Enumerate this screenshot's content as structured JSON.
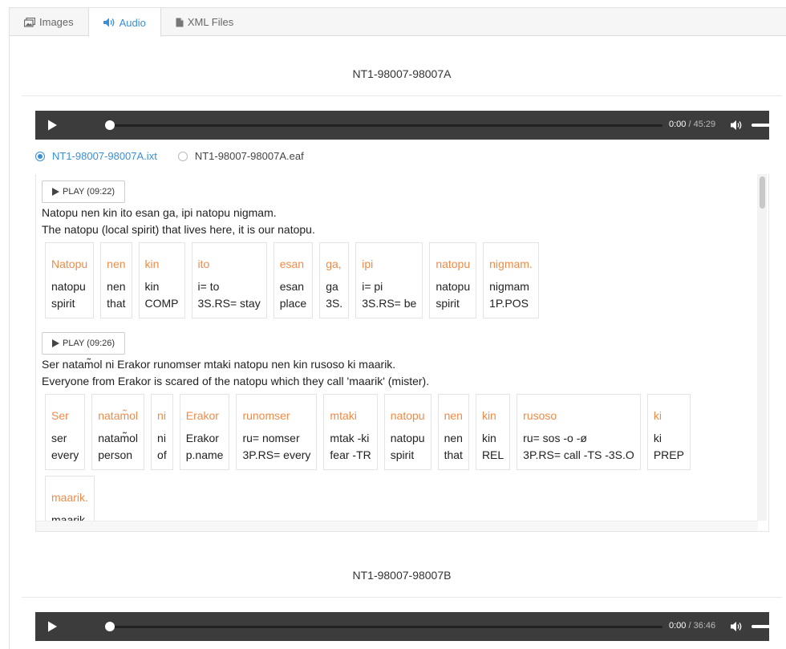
{
  "tabs": [
    {
      "label": "Images",
      "icon": "images-icon",
      "active": false
    },
    {
      "label": "Audio",
      "icon": "audio-icon",
      "active": true
    },
    {
      "label": "XML Files",
      "icon": "file-icon",
      "active": false
    }
  ],
  "records": [
    {
      "title": "NT1-98007-98007A",
      "player": {
        "current": "0:00",
        "separator": "/",
        "duration": "45:29",
        "progress": 0.0,
        "volume": 1.0
      },
      "files": [
        {
          "label": "NT1-98007-98007A.ixt",
          "checked": true
        },
        {
          "label": "NT1-98007-98007A.eaf",
          "checked": false
        }
      ],
      "segments": [
        {
          "play_label": "PLAY (09:22)",
          "original": "Natopu nen kin ito esan ga, ipi natopu nigmam.",
          "translation": "The natopu (local spirit) that lives here, it is our natopu.",
          "words": [
            {
              "word": "Natopu",
              "morph": "natopu",
              "gloss": "spirit"
            },
            {
              "word": "nen",
              "morph": "nen",
              "gloss": "that"
            },
            {
              "word": "kin",
              "morph": "kin",
              "gloss": "COMP"
            },
            {
              "word": "ito",
              "morph": "i= to",
              "gloss": "3S.RS= stay"
            },
            {
              "word": "esan",
              "morph": "esan",
              "gloss": "place"
            },
            {
              "word": "ga,",
              "morph": "ga",
              "gloss": "3S."
            },
            {
              "word": "ipi",
              "morph": "i= pi",
              "gloss": "3S.RS= be"
            },
            {
              "word": "natopu",
              "morph": "natopu",
              "gloss": "spirit"
            },
            {
              "word": "nigmam.",
              "morph": "nigmam",
              "gloss": "1P.POS"
            }
          ]
        },
        {
          "play_label": "PLAY (09:26)",
          "original": "Ser natam̃ol ni Erakor runomser mtaki natopu nen kin rusoso ki maarik.",
          "translation": "Everyone from Erakor is scared of the natopu which they call 'maarik' (mister).",
          "words": [
            {
              "word": "Ser",
              "morph": "ser",
              "gloss": "every"
            },
            {
              "word": "natam̃ol",
              "morph": "natam̃ol",
              "gloss": "person"
            },
            {
              "word": "ni",
              "morph": "ni",
              "gloss": "of"
            },
            {
              "word": "Erakor",
              "morph": "Erakor",
              "gloss": "p.name"
            },
            {
              "word": "runomser",
              "morph": "ru= nomser",
              "gloss": "3P.RS= every"
            },
            {
              "word": "mtaki",
              "morph": "mtak -ki",
              "gloss": "fear -TR"
            },
            {
              "word": "natopu",
              "morph": "natopu",
              "gloss": "spirit"
            },
            {
              "word": "nen",
              "morph": "nen",
              "gloss": "that"
            },
            {
              "word": "kin",
              "morph": "kin",
              "gloss": "REL"
            },
            {
              "word": "rusoso",
              "morph": "ru= sos -o -ø",
              "gloss": "3P.RS= call -TS -3S.O"
            },
            {
              "word": "ki",
              "morph": "ki",
              "gloss": "PREP"
            },
            {
              "word": "maarik.",
              "morph": "maarik",
              "gloss": ""
            }
          ]
        }
      ]
    },
    {
      "title": "NT1-98007-98007B",
      "player": {
        "current": "0:00",
        "separator": "/",
        "duration": "36:46",
        "progress": 0.0,
        "volume": 1.0
      }
    }
  ],
  "colors": {
    "accent": "#3a8fd8",
    "word": "#ee8b47",
    "player_bg": "#3c3c3c"
  }
}
